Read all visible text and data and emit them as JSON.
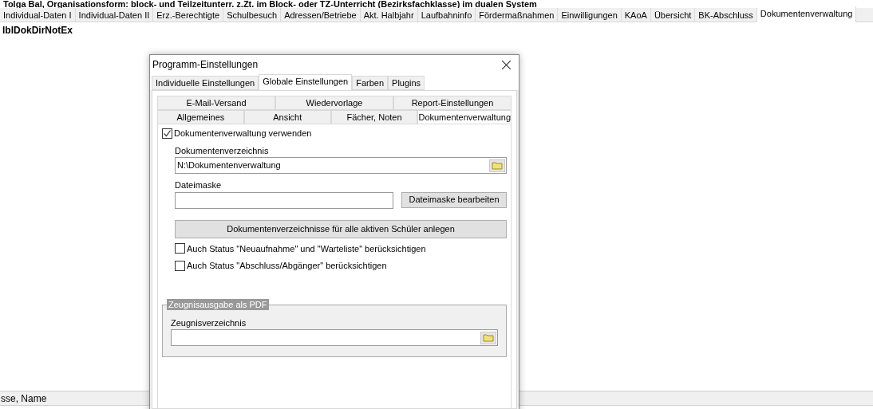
{
  "header_text": "Tolga Bal, Organisationsform: block- und Teilzeitunterr. z.Zt. im Block- oder TZ-Unterricht (Bezirksfachklasse) im dualen System",
  "tabs": [
    {
      "label": "Individual-Daten I",
      "selected": false
    },
    {
      "label": "Individual-Daten II",
      "selected": false
    },
    {
      "label": "Erz.-Berechtigte",
      "selected": false
    },
    {
      "label": "Schulbesuch",
      "selected": false
    },
    {
      "label": "Adressen/Betriebe",
      "selected": false
    },
    {
      "label": "Akt. Halbjahr",
      "selected": false
    },
    {
      "label": "Laufbahninfo",
      "selected": false
    },
    {
      "label": "Fördermaßnahmen",
      "selected": false
    },
    {
      "label": "Einwilligungen",
      "selected": false
    },
    {
      "label": "KAoA",
      "selected": false
    },
    {
      "label": "Übersicht",
      "selected": false
    },
    {
      "label": "BK-Abschluss",
      "selected": false
    },
    {
      "label": "Dokumentenverwaltung",
      "selected": true
    }
  ],
  "page_label": "lblDokDirNotEx",
  "grid_header": "sse, Name",
  "dialog": {
    "title": "Programm-Einstellungen",
    "tabs": [
      {
        "label": "Individuelle Einstellungen",
        "selected": false
      },
      {
        "label": "Globale Einstellungen",
        "selected": true
      },
      {
        "label": "Farben",
        "selected": false
      },
      {
        "label": "Plugins",
        "selected": false
      }
    ],
    "subtab_rows": [
      [
        {
          "label": "E-Mail-Versand",
          "selected": false
        },
        {
          "label": "Wiedervorlage",
          "selected": false
        },
        {
          "label": "Report-Einstellungen",
          "selected": false
        }
      ],
      [
        {
          "label": "Allgemeines",
          "selected": false
        },
        {
          "label": "Ansicht",
          "selected": false
        },
        {
          "label": "Fächer, Noten",
          "selected": false
        },
        {
          "label": "Dokumentenverwaltung",
          "selected": true
        }
      ]
    ],
    "use_checkbox": {
      "label": "Dokumentenverwaltung verwenden",
      "checked": true
    },
    "dir_label": "Dokumentenverzeichnis",
    "dir_value": "N:\\Dokumentenverwaltung",
    "mask_label": "Dateimaske",
    "mask_button": "Dateimaske bearbeiten",
    "create_button": "Dokumentenverzeichnisse für alle aktiven Schüler anlegen",
    "options": [
      {
        "label": "Auch Status \"Neuaufnahme\" und \"Warteliste\" berücksichtigen",
        "checked": false
      },
      {
        "label": "Auch Status \"Abschluss/Abgänger\" berücksichtigen",
        "checked": false
      }
    ],
    "group": {
      "title": "Zeugnisausgabe als PDF",
      "field_label": "Zeugnisverzeichnis"
    }
  }
}
